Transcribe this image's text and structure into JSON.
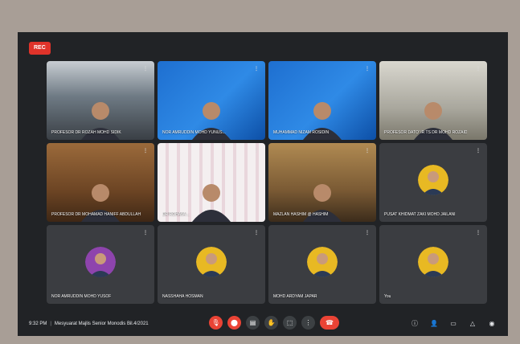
{
  "recording": {
    "label": "REC"
  },
  "participants": [
    {
      "name": "PROFESOR DR ROZAH MOHD SIDIK",
      "style": "office",
      "avatar": false
    },
    {
      "name": "NOR AMRUDDIN MOHD YUNUS...",
      "style": "slide",
      "avatar": false
    },
    {
      "name": "MUHAMMAD NIZAM ROSIDIN",
      "style": "slide",
      "avatar": false
    },
    {
      "name": "PROFESOR DATO' IR TS DR MOHD ROZAID",
      "style": "shelf",
      "avatar": false
    },
    {
      "name": "PROFESOR DR MOHAMAD HANIFF ABDULLAH",
      "style": "wood",
      "avatar": false
    },
    {
      "name": "DR ROHAYA ...",
      "style": "pattern",
      "avatar": false
    },
    {
      "name": "MAZLAN HASHIM @ HASHIM",
      "style": "room",
      "avatar": false
    },
    {
      "name": "PUSAT KHIDMAT ZAKI MOHD JAILANI",
      "style": "grey",
      "avatar": true
    },
    {
      "name": "NOR AMRUDDIN MOHD YUSOF",
      "style": "grey",
      "avatar": true
    },
    {
      "name": "NASSHAHA HOSMAN",
      "style": "grey",
      "avatar": true
    },
    {
      "name": "MOHD ARDYAM JAPAR",
      "style": "grey",
      "avatar": true
    },
    {
      "name": "You",
      "style": "grey",
      "avatar": true
    }
  ],
  "bottom_bar": {
    "time": "9:32 PM",
    "meeting_title": "Mesyuarat Majlis Senior Monodis Bil.4/2021"
  },
  "controls": [
    {
      "icon": "mic-off-icon",
      "glyph": "🎙"
    },
    {
      "icon": "camera-off-icon",
      "glyph": "⬤"
    },
    {
      "icon": "captions-icon",
      "glyph": "▤"
    },
    {
      "icon": "raise-hand-icon",
      "glyph": "✋"
    },
    {
      "icon": "present-icon",
      "glyph": "⬚"
    },
    {
      "icon": "more-options-icon",
      "glyph": "⋮"
    },
    {
      "icon": "end-call-icon",
      "glyph": "☎"
    }
  ],
  "right_icons": [
    {
      "icon": "info-icon",
      "glyph": "ⓘ"
    },
    {
      "icon": "people-icon",
      "glyph": "👤"
    },
    {
      "icon": "chat-icon",
      "glyph": "▭"
    },
    {
      "icon": "activities-icon",
      "glyph": "△"
    },
    {
      "icon": "host-controls-icon",
      "glyph": "◉"
    }
  ],
  "colors": {
    "accent": "#ea4335",
    "background": "#212326",
    "tile": "#3b3d41"
  }
}
